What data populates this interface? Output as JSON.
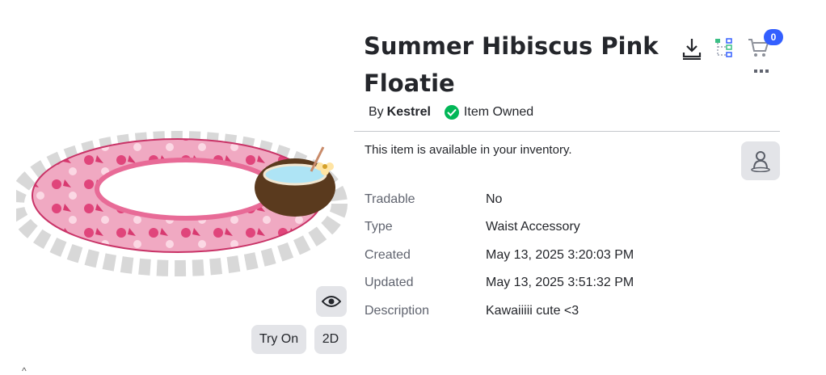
{
  "item": {
    "title": "Summer Hibiscus Pink Floatie",
    "by_label": "By",
    "creator": "Kestrel",
    "owned_label": "Item Owned",
    "availability": "This item is available in your inventory."
  },
  "header_actions": {
    "cart_count": "0",
    "icons": [
      "download-icon",
      "hierarchy-icon",
      "cart-icon",
      "more-icon"
    ]
  },
  "preview": {
    "try_on_label": "Try On",
    "two_d_label": "2D",
    "icons": [
      "eye-icon"
    ]
  },
  "details": [
    {
      "label": "Tradable",
      "value": "No"
    },
    {
      "label": "Type",
      "value": "Waist Accessory"
    },
    {
      "label": "Created",
      "value": "May 13, 2025 3:20:03 PM"
    },
    {
      "label": "Updated",
      "value": "May 13, 2025 3:51:32 PM"
    },
    {
      "label": "Description",
      "value": "Kawaiiiii cute <3"
    }
  ],
  "colors": {
    "accent": "#335fff",
    "owned_green": "#02b757",
    "button_grey": "#e3e4e8",
    "floatie_pink": "#e0457b"
  }
}
